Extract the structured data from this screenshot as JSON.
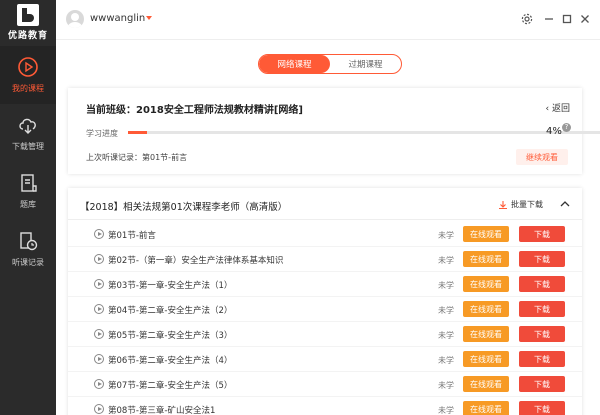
{
  "app": {
    "logo_text": "优路教育"
  },
  "sidebar": {
    "items": [
      {
        "label": "我的课程",
        "icon": "play-circle-icon",
        "active": true
      },
      {
        "label": "下载管理",
        "icon": "cloud-download-icon",
        "active": false
      },
      {
        "label": "题库",
        "icon": "question-bank-icon",
        "active": false
      },
      {
        "label": "听课记录",
        "icon": "history-icon",
        "active": false
      }
    ]
  },
  "topbar": {
    "username": "wwwanglin"
  },
  "tabs": [
    {
      "label": "网络课程",
      "active": true
    },
    {
      "label": "过期课程",
      "active": false
    }
  ],
  "current_class": {
    "title": "当前班级：2018安全工程师法规教材精讲[网络]",
    "back_label": "返回",
    "progress_label": "学习进度",
    "progress_value": 4,
    "progress_text": "4%",
    "last_record": "上次听课记录：第01节-前言",
    "continue_label": "继续观看"
  },
  "course": {
    "title": "【2018】相关法规第01次课程李老师（高清版）",
    "batch_download_label": "批量下载",
    "lessons": [
      {
        "name": "第01节-前言",
        "status": "未学",
        "watch": "在线观看",
        "download": "下载"
      },
      {
        "name": "第02节-（第一章）安全生产法律体系基本知识",
        "status": "未学",
        "watch": "在线观看",
        "download": "下载"
      },
      {
        "name": "第03节-第一章-安全生产法（1）",
        "status": "未学",
        "watch": "在线观看",
        "download": "下载"
      },
      {
        "name": "第04节-第二章-安全生产法（2）",
        "status": "未学",
        "watch": "在线观看",
        "download": "下载"
      },
      {
        "name": "第05节-第二章-安全生产法（3）",
        "status": "未学",
        "watch": "在线观看",
        "download": "下载"
      },
      {
        "name": "第06节-第二章-安全生产法（4）",
        "status": "未学",
        "watch": "在线观看",
        "download": "下载"
      },
      {
        "name": "第07节-第二章-安全生产法（5）",
        "status": "未学",
        "watch": "在线观看",
        "download": "下载"
      },
      {
        "name": "第08节-第三章-矿山安全法1",
        "status": "未学",
        "watch": "在线观看",
        "download": "下载"
      }
    ]
  },
  "colors": {
    "accent": "#ff5a36",
    "watch": "#f79a25",
    "download": "#f04b3a",
    "sidebar": "#2b2b2b"
  }
}
